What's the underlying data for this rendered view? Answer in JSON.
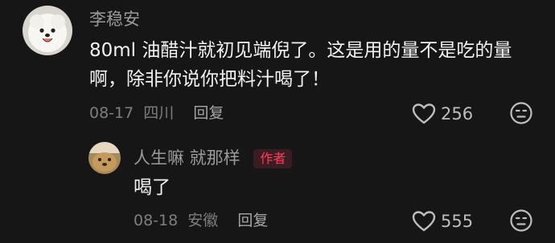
{
  "comments": [
    {
      "username": "李稳安",
      "text_line1": "80ml 油醋汁就初见端倪了。这是用的量不是吃的量",
      "text_line2": "啊，除非你说你把料汁喝了！",
      "date": "08-17",
      "location": "四川",
      "reply_label": "回复",
      "likes": "256"
    },
    {
      "username": "人生嘛 就那样",
      "badge": "作者",
      "text_line1": "喝了",
      "date": "08-18",
      "location": "安徽",
      "reply_label": "回复",
      "likes": "555"
    }
  ],
  "icons": {
    "like": "heart-outline-icon",
    "dislike": "neutral-face-icon"
  },
  "colors": {
    "background": "#161616",
    "text": "#f2f2f2",
    "muted": "#7d7d7d",
    "author_badge": "#ff3b5c"
  }
}
